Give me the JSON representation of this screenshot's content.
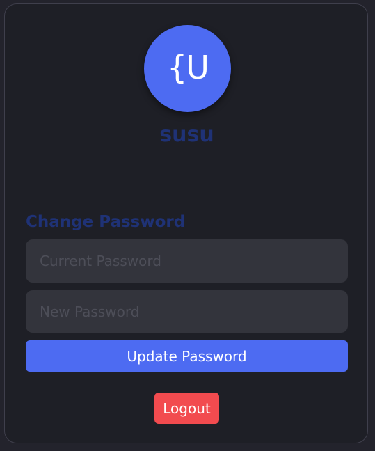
{
  "profile": {
    "avatar_initials": "{U",
    "username": "susu"
  },
  "change_password": {
    "title": "Change Password",
    "current_placeholder": "Current Password",
    "current_value": "",
    "new_placeholder": "New Password",
    "new_value": "",
    "update_label": "Update Password"
  },
  "actions": {
    "logout_label": "Logout"
  },
  "colors": {
    "accent": "#4d6bf2",
    "danger": "#f24b4f",
    "title": "#1f3276",
    "card_bg": "#1e1f26",
    "input_bg": "#33343c"
  }
}
